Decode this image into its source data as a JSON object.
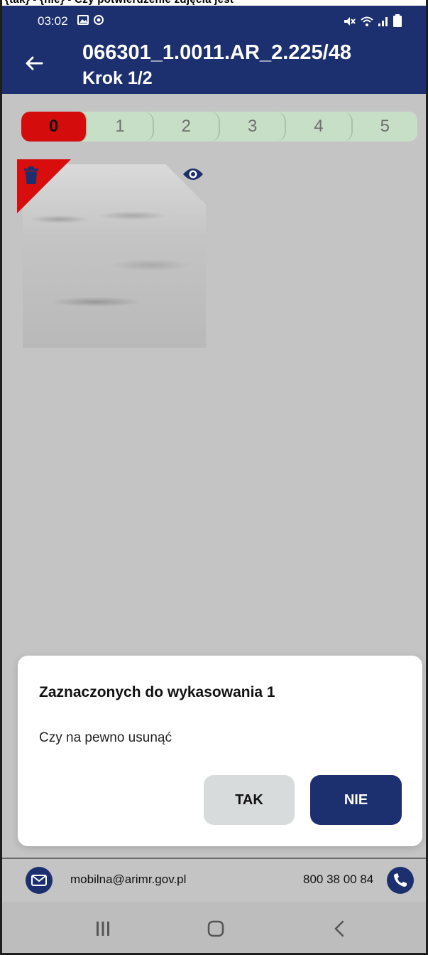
{
  "top_crop_text": "{tak} - {nie} - Czy potwierdzenie zdjęcia jest",
  "status_bar": {
    "time": "03:02",
    "left_icons": [
      "image-icon",
      "location-icon"
    ],
    "right_icons": [
      "mute-icon",
      "wifi-icon",
      "signal-icon",
      "battery-icon"
    ]
  },
  "header": {
    "title": "066301_1.0011.AR_2.225/48",
    "subtitle": "Krok 1/2"
  },
  "steps": [
    {
      "label": "0",
      "active": true
    },
    {
      "label": "1",
      "active": false
    },
    {
      "label": "2",
      "active": false
    },
    {
      "label": "3",
      "active": false
    },
    {
      "label": "4",
      "active": false
    },
    {
      "label": "5",
      "active": false
    }
  ],
  "photo": {
    "marked_for_delete": true,
    "icons": [
      "trash-icon",
      "eye-icon"
    ]
  },
  "dialog": {
    "title": "Zaznaczonych do wykasowania 1",
    "message": "Czy na pewno usunąć",
    "yes_label": "TAK",
    "no_label": "NIE"
  },
  "contact": {
    "email": "mobilna@arimr.gov.pl",
    "phone": "800 38 00 84"
  },
  "colors": {
    "primary": "#1c2f6e",
    "active_step": "#d40c0c",
    "inactive_step": "#c7dfc6",
    "background": "#c4c4c4"
  }
}
